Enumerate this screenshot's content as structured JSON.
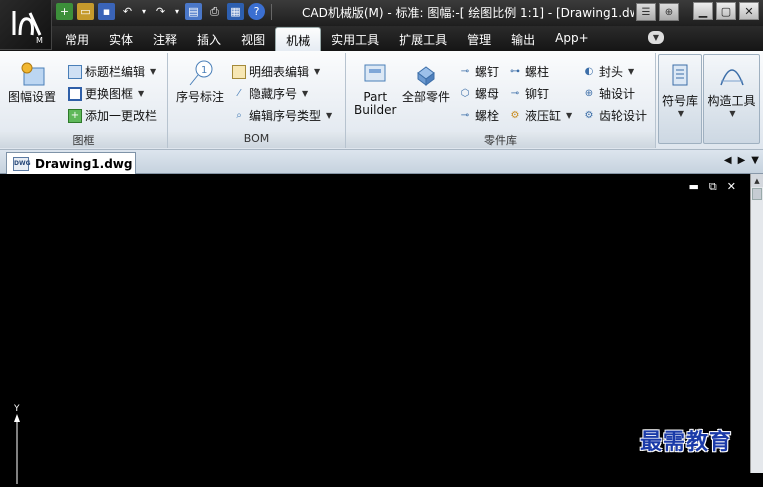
{
  "window": {
    "title": "CAD机械版(M) - 标准: 图幅:-[ 绘图比例 1:1] - [Drawing1.dw",
    "min": "▁",
    "restore": "▢",
    "close": "✕"
  },
  "tabs": [
    "常用",
    "实体",
    "注释",
    "插入",
    "视图",
    "机械",
    "实用工具",
    "扩展工具",
    "管理",
    "输出",
    "App+"
  ],
  "active_tab": "机械",
  "ribbon": {
    "frame": {
      "title": "图框",
      "big": "图幅设置",
      "items": [
        "标题栏编辑",
        "更换图框",
        "添加一更改栏"
      ]
    },
    "bom": {
      "title": "BOM",
      "big": "序号标注",
      "items": [
        "明细表编辑",
        "隐藏序号",
        "编辑序号类型"
      ]
    },
    "parts": {
      "title": "零件库",
      "part_builder": "Part\nBuilder",
      "part_builder_l1": "Part",
      "part_builder_l2": "Builder",
      "all_parts": "全部零件",
      "col1": [
        "螺钉",
        "螺母",
        "螺栓"
      ],
      "col2": [
        "螺柱",
        "铆钉",
        "液压缸"
      ],
      "col3": [
        "封头",
        "轴设计",
        "齿轮设计"
      ]
    },
    "symbol_lib": "符号库",
    "construct_tool": "构造工具"
  },
  "doc_tab": "Drawing1.dwg",
  "ucs": {
    "y": "Y"
  },
  "watermark": "最需教育",
  "colors": {
    "accent": "#1a3aa8"
  }
}
